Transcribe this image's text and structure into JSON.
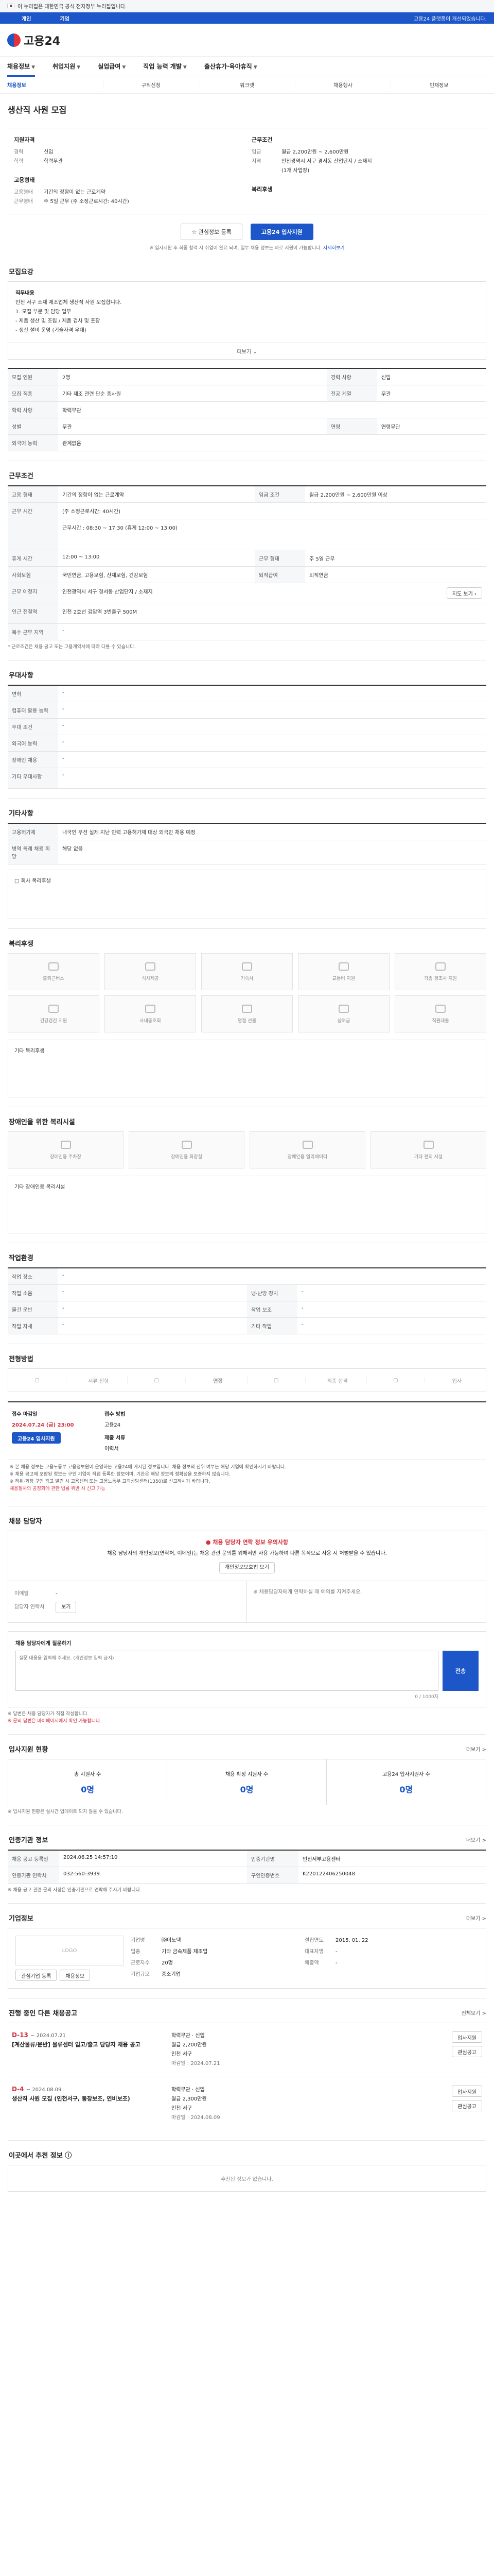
{
  "gov_bar": {
    "text": "이 누리집은 대한민국 공식 전자정부 누리집입니다."
  },
  "gov_sub": {
    "tabs": [
      "개인",
      "기업"
    ],
    "right": "고용24 플랫폼이 개선되었습니다."
  },
  "header": {
    "logo": "고용24"
  },
  "gnb": [
    "채용정보",
    "취업지원",
    "실업급여",
    "직업 능력 개발",
    "출산휴가·육아휴직"
  ],
  "subnav": [
    "채용정보",
    "구직신청",
    "워크넷",
    "채용행사",
    "인재정보"
  ],
  "job": {
    "name": "생산직 사원 모집",
    "qual_title": "지원자격",
    "qual": [
      [
        "경력",
        "신입"
      ],
      [
        "학력",
        "학력무관"
      ]
    ],
    "cond_title": "근무조건",
    "cond": [
      [
        "임금",
        "월급 2,200만원 ~ 2,600만원"
      ],
      [
        "지역",
        "인천광역시 서구 경서동 산업단지 / 소재지"
      ],
      [
        "",
        "(1개 사업장)"
      ]
    ],
    "cond2_title": "고용형태",
    "cond2": [
      [
        "고용형태",
        "기간의 정함이 없는 근로계약"
      ],
      [
        "근무형태",
        "주 5일 근무 (주 소정근로시간: 40시간)"
      ]
    ],
    "welfare_title": "복리후생",
    "apply_btn_outline": "관심정보 등록",
    "apply_btn": "고용24 입사지원",
    "note": "※ 입사지원 후 최종 합격 시 취업이 완료 되며, 일부 채용 정보는 바로 지원이 가능합니다.",
    "note_link": "자세히보기"
  },
  "recruit": {
    "title": "모집요강",
    "box_label": "직무내용",
    "box_lines": [
      "인천 서구 소재 제조업체 생산직 사원 모집합니다.",
      "1. 모집 부문 및 담당 업무",
      "- 제품 생산 및 조립 / 제품 검사 및 포장",
      "- 생산 설비 운영 (기술자격 우대)"
    ],
    "toggle": "더보기 ⌄",
    "rows": [
      [
        "모집 인원",
        "2명",
        "경력 사항",
        "신입"
      ],
      [
        "모집 직종",
        "기타 제조 관련 단순 종사원",
        "전공 계열",
        "무관"
      ],
      [
        "학력 사항",
        "학력무관",
        "",
        ""
      ],
      [
        "성별",
        "무관",
        "연령",
        "연령무관"
      ],
      [
        "외국어 능력",
        "관계없음",
        "",
        ""
      ]
    ]
  },
  "work": {
    "title": "근무조건",
    "rows": [
      [
        "고용 형태",
        "기간의 정함이 없는 근로계약",
        "임금 조건",
        "월급 2,200만원 ~ 2,600만원 이상"
      ],
      [
        "근무 시간",
        "(주 소정근로시간: 40시간)",
        "",
        ""
      ],
      [
        "",
        "근무시간 : 08:30 ~ 17:30 (휴게 12:00 ~ 13:00)",
        "",
        ""
      ],
      [
        "휴게 시간",
        "12:00 ~ 13:00",
        "근무 형태",
        "주 5일 근무"
      ],
      [
        "사회보험",
        "국민연금, 고용보험, 산재보험, 건강보험",
        "퇴직급여",
        "퇴직연금"
      ],
      [
        "근무 예정지",
        "인천광역시 서구 경서동 산업단지 / 소재지",
        "",
        ""
      ],
      [
        "인근 전철역",
        "인천 2호선 검암역 3번출구 500M",
        "",
        ""
      ],
      [
        "복수 근무 지역",
        "-",
        "",
        ""
      ]
    ],
    "footnote": "* 근로조건은 채용 공고 또는 고용계약서에 따라 다를 수 있습니다."
  },
  "pref": {
    "title": "우대사항",
    "rows": [
      [
        "면허",
        "-"
      ],
      [
        "컴퓨터 활용 능력",
        "-"
      ],
      [
        "우대 조건",
        "-"
      ],
      [
        "외국어 능력",
        "-"
      ],
      [
        "장애인 채용",
        "-"
      ],
      [
        "기타 우대사항",
        "-"
      ]
    ]
  },
  "etc": {
    "title": "기타사항",
    "rows": [
      [
        "고용허가제",
        "내국인 우선 실제 지난 인력 고용허가제 대상 외국인 채용 예정"
      ],
      [
        "병역 특례 채용 희망",
        "해당 없음"
      ]
    ],
    "box_label": "□ 회사 복리후생"
  },
  "welfare": {
    "title": "복리후생",
    "items": [
      "출퇴근버스",
      "식사제공",
      "기숙사",
      "교통비 지원",
      "각종 경조사 지원",
      "건강검진 지원",
      "사내동호회",
      "명절 선물",
      "상여금",
      "직원대출"
    ],
    "box_label": "기타 복리후생"
  },
  "disabled": {
    "title": "장애인을 위한 복리시설",
    "items": [
      "장애인용 주차장",
      "장애인용 화장실",
      "장애인용 엘리베이터",
      "기타 편의 시설"
    ],
    "box_label": "기타 장애인용 복리시설"
  },
  "env": {
    "title": "작업환경",
    "rows": [
      [
        "작업 장소",
        "-",
        "",
        " "
      ],
      [
        "작업 소음",
        "-",
        "냉·난방 장치",
        "-"
      ],
      [
        "물건 운반",
        "-",
        "작업 보조",
        "-"
      ],
      [
        "작업 자세",
        "-",
        "기타 작업",
        "-"
      ]
    ]
  },
  "process": {
    "title": "전형방법",
    "steps": [
      "서류 전형",
      "면접",
      "최종 합격",
      "입사"
    ],
    "deadline_label": "접수 마감일",
    "deadline": "2024.07.24 (금) 23:00",
    "deadline_btn": "고용24 입사지원",
    "method_label": "접수 방법",
    "method": "고용24",
    "form_label": "제출 서류",
    "form": "이력서",
    "warnings": [
      "※ 본 채용 정보는 고용노동부 고용정보원이 운영하는 고용24에 게시된 정보입니다. 채용 정보의 진위 여부는 해당 기업에 확인하시기 바랍니다.",
      "※ 채용 공고에 포함된 정보는 구인 기업이 직접 등록한 정보이며, 기관은 해당 정보의 정확성을 보증하지 않습니다.",
      "※ 허위·과장 구인 광고 발견 시 고용센터 또는 고용노동부 고객상담센터(1350)로 신고하시기 바랍니다."
    ],
    "warn_red": "채용절차의 공정화에 관한 법률 위반 시 신고 가능"
  },
  "contact": {
    "title": "채용 담당자",
    "head": "채용 담당자 연락 정보 유의사항",
    "body": "채용 담당자의 개인정보(연락처, 이메일)는 채용 관련 문의를 위해서만 사용 가능하며 다른 목적으로 사용 시 처벌받을 수 있습니다.",
    "btn": "개인정보보호법 보기",
    "left_label": "이메일",
    "left_val": "-",
    "left_label2": "담당자 연락처",
    "left_btn": "보기",
    "right": "※ 채용담당자에게 연락하실 때 예의를 지켜주세요.",
    "msg_label": "채용 담당자에게 질문하기",
    "msg_placeholder": "질문 내용을 입력해 주세요. (개인정보 입력 금지)",
    "msg_btn": "전송",
    "msg_counter": "0 / 1000자",
    "msg_notes": [
      "※ 답변은 채용 담당자가 직접 작성합니다.",
      "※ 문의 답변은 마이페이지에서 확인 가능합니다."
    ]
  },
  "stats": {
    "title": "입사지원 현황",
    "more": "더보기 >",
    "items": [
      [
        "총 지원자 수",
        "0명"
      ],
      [
        "채용 확정 지원자 수",
        "0명"
      ],
      [
        "고용24 입사지원자 수",
        "0명"
      ]
    ],
    "note": "※ 입사지원 현황은 실시간 업데이트 되지 않을 수 있습니다."
  },
  "agency": {
    "title": "인증기관 정보",
    "more": "더보기 >",
    "rows": [
      [
        "채용 공고 등록일",
        "2024.06.25 14:57:10",
        "인증기관명",
        "인천서부고용센터"
      ],
      [
        "인증기관 연락처",
        "032-560-3939",
        "구인인증번호",
        "K220122406250048"
      ]
    ],
    "note": "※ 채용 공고 관련 문의 사항은 인증기관으로 연락해 주시기 바랍니다."
  },
  "company": {
    "title": "기업정보",
    "more": "더보기 >",
    "logo_alt": "LOGO",
    "btns": [
      "관심기업 등록",
      "채용정보"
    ],
    "rows": [
      [
        "기업명",
        "㈜이노텍",
        "설립연도",
        "2015. 01. 22"
      ],
      [
        "업종",
        "기타 금속제품 제조업",
        "대표자명",
        "-"
      ],
      [
        "근로자수",
        "20명",
        "매출액",
        "-"
      ],
      [
        "기업규모",
        "중소기업",
        "",
        ""
      ]
    ]
  },
  "others": {
    "title": "진행 중인 다른 채용공고",
    "more": "전체보기 >",
    "items": [
      {
        "dday": "D-13",
        "date": "~ 2024.07.21",
        "title": "[계산물류/운반] 물류센터 입고/출고 담당자 채용 공고",
        "edu": "학력무관",
        "career": "신입",
        "pay": "월급 2,200만원",
        "loc": "인천 서구",
        "end": "마감일 : 2024.07.21",
        "btns": [
          "입사지원",
          "관심공고"
        ]
      },
      {
        "dday": "D-4",
        "date": "~ 2024.08.09",
        "title": "생산직 사원 모집 (인천서구, 통장보조, 연비보조)",
        "edu": "학력무관",
        "career": "신입",
        "pay": "월급 2,300만원",
        "loc": "인천 서구",
        "end": "마감일 : 2024.08.09",
        "btns": [
          "입사지원",
          "관심공고"
        ]
      }
    ]
  },
  "recommend": {
    "title": "이곳에서 추천 정보 ⓘ",
    "text": "추천된 정보가 없습니다."
  }
}
